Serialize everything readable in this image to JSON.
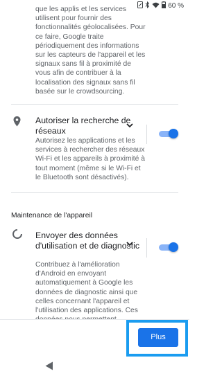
{
  "status_bar": {
    "battery_percent": "60 %"
  },
  "location_text": "que les applis et les services utilisent pour fournir des fonctionnalités géolocalisées. Pour ce faire, Google traite périodiquement des informations sur les capteurs de l'appareil et les signaux sans fil à proximité de vous afin de contribuer à la localisation des signaux sans fil basée sur le crowdsourcing.",
  "wifi_scan": {
    "title": "Autoriser la recherche de réseaux",
    "description": "Autorisez les applications et les services à rechercher des réseaux Wi-Fi et les appareils à proximité à tout moment (même si le Wi-Fi et le Bluetooth sont désactivés).",
    "enabled": true
  },
  "section_label": "Maintenance de l'appareil",
  "diagnostics": {
    "title": "Envoyer des données d'utilisation et de diagnostic",
    "description": "Contribuez à l'amélioration d'Android en envoyant automatiquement à Google les données de diagnostic ainsi que celles concernant l'appareil et l'utilisation des applications. Ces données nous permettent d'optimiser",
    "enabled": true
  },
  "footer": {
    "more_button": "Plus"
  },
  "colors": {
    "accent": "#1a73e8",
    "highlight": "#1a9cf0"
  }
}
